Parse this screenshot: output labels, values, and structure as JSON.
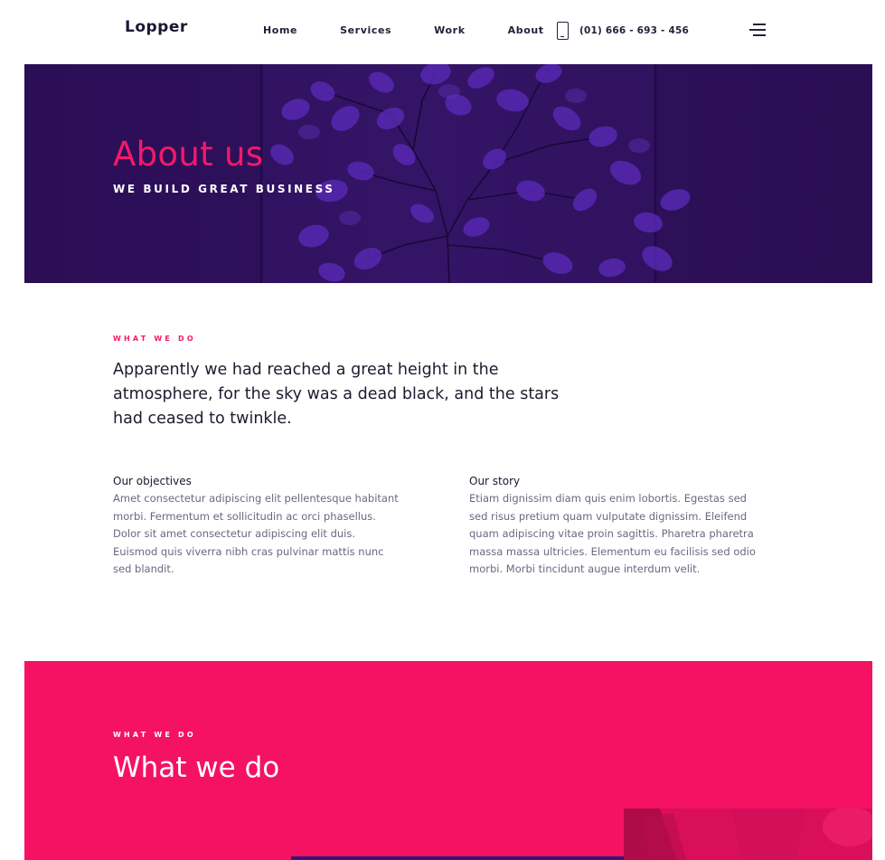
{
  "header": {
    "logo": "Lopper",
    "nav": [
      {
        "label": "Home"
      },
      {
        "label": "Services"
      },
      {
        "label": "Work"
      },
      {
        "label": "About"
      }
    ],
    "phone": "(01) 666 - 693 - 456",
    "phone_icon": "mobile-phone-icon",
    "menu_icon": "hamburger-menu-icon"
  },
  "hero": {
    "title": "About us",
    "subtitle": "WE BUILD GREAT BUSINESS"
  },
  "intro": {
    "eyebrow": "WHAT WE DO",
    "text": "Apparently we had reached a great height in the atmosphere, for the sky was a dead black, and the stars had ceased to twinkle.",
    "columns": [
      {
        "title": "Our objectives",
        "body": "Amet consectetur adipiscing elit pellentesque habitant morbi. Fermentum et sollicitudin ac orci phasellus. Dolor sit amet consectetur adipiscing elit duis. Euismod quis viverra nibh cras pulvinar mattis nunc sed blandit."
      },
      {
        "title": "Our story",
        "body": "Etiam dignissim diam quis enim lobortis. Egestas sed sed risus pretium quam vulputate dignissim. Eleifend quam adipiscing vitae proin sagittis. Pharetra pharetra massa massa ultricies. Elementum eu facilisis sed odio morbi. Morbi tincidunt augue interdum velit."
      }
    ]
  },
  "what_we_do": {
    "eyebrow": "WHAT WE DO",
    "title": "What we do"
  },
  "colors": {
    "accent": "#f5186a",
    "hero_purple": "#341466",
    "pink_section": "#f51262",
    "text_dark": "#1f1a2e",
    "text_muted": "#6b6780"
  }
}
